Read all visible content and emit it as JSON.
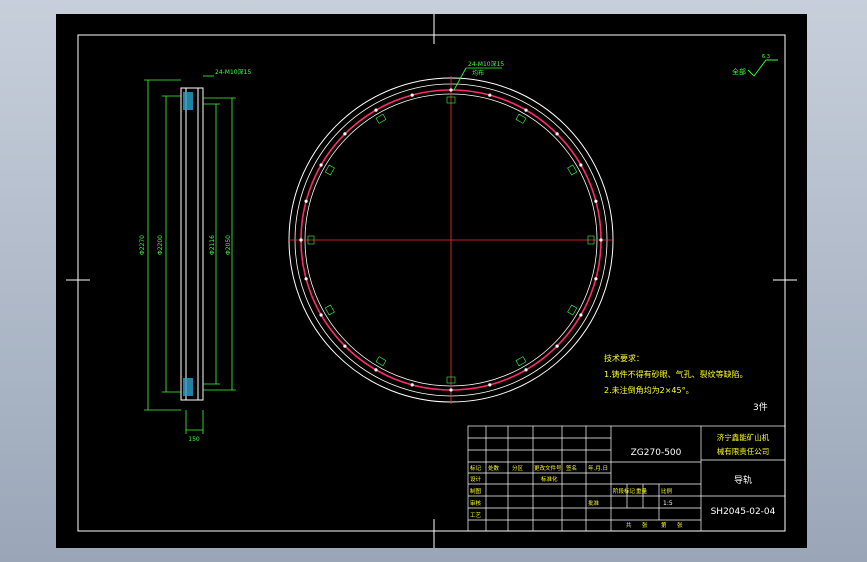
{
  "drawing": {
    "material_code": "ZG270-500",
    "company_line1": "济宁鑫能矿山机",
    "company_line2": "械有限责任公司",
    "part_name": "导轨",
    "drawing_number": "SH2045-02-04",
    "scale": "1:5",
    "quantity": "3件",
    "roughness": "全部",
    "roughness_value": "6.3",
    "tech_title": "技术要求：",
    "tech_1": "1.铸件不得有砂眼、气孔、裂纹等缺陷。",
    "tech_2": "2.未注倒角均为2×45°。",
    "hole_note": "24-M10深15",
    "hole_note2": "均布",
    "top_note": "24-M10深15",
    "dim_outer": "Φ2270",
    "dim_a": "Φ2200",
    "dim_b": "Φ2116",
    "dim_c": "Φ2050",
    "dim_width": "150",
    "title_headers": [
      "标记",
      "处数",
      "分区",
      "更改文件号",
      "签名",
      "年.月.日"
    ],
    "title_rows": [
      "设计",
      "制图",
      "审核",
      "工艺"
    ],
    "std_label": "标准化",
    "stage_labels": [
      "阶段标记",
      "重量",
      "比例"
    ],
    "sheet_labels": [
      "共",
      "张",
      "第",
      "张"
    ],
    "approve_label": "批准"
  }
}
